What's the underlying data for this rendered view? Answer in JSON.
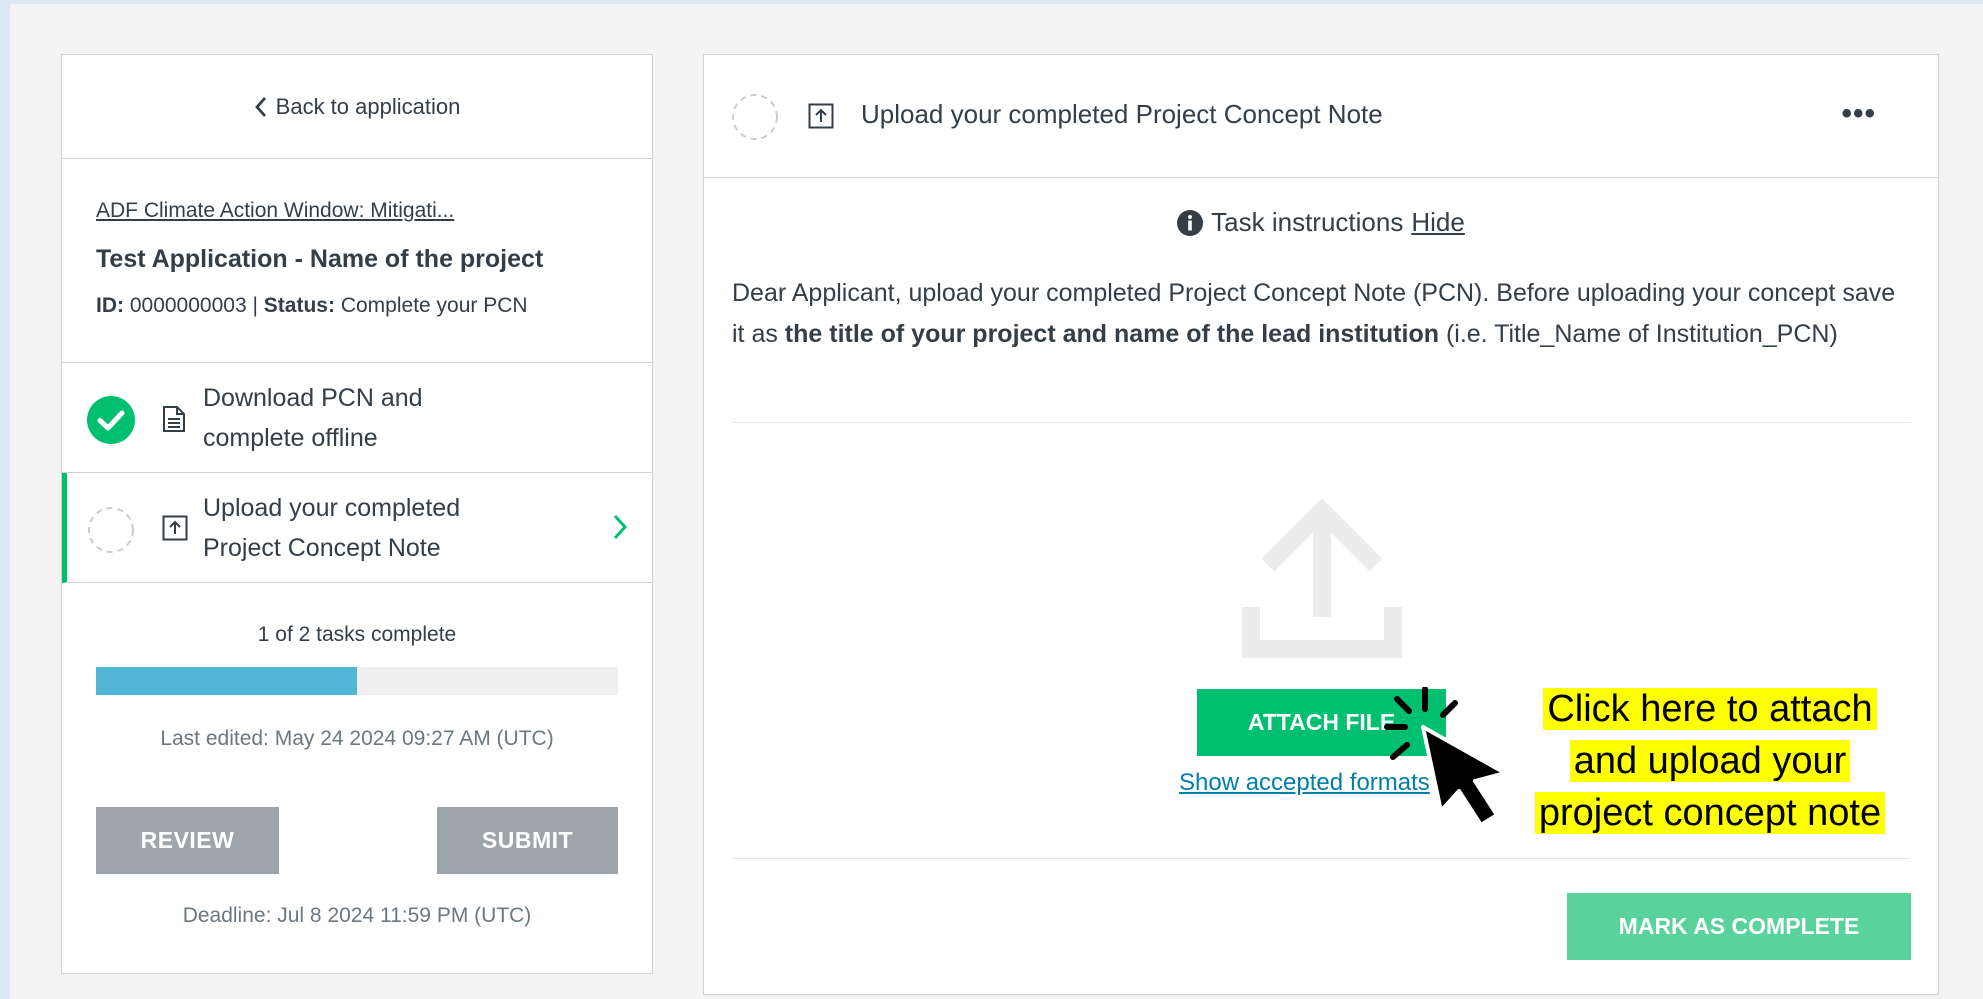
{
  "sidebar": {
    "back_label": "Back to application",
    "app_link": "ADF Climate Action Window: Mitigati...",
    "app_title": "Test Application - Name of the project",
    "id_label": "ID:",
    "id_value": "0000000003",
    "separator": "|",
    "status_label": "Status:",
    "status_value": "Complete your PCN",
    "tasks": [
      {
        "label": "Download PCN and complete offline",
        "state": "complete",
        "icon": "document-icon"
      },
      {
        "label": "Upload your completed Project Concept Note",
        "state": "active",
        "icon": "upload-box-icon"
      }
    ],
    "progress_text": "1 of 2 tasks complete",
    "progress_fraction": 0.5,
    "last_edited": "Last edited: May 24 2024 09:27 AM (UTC)",
    "review_label": "REVIEW",
    "submit_label": "SUBMIT",
    "deadline": "Deadline: Jul 8 2024 11:59 PM (UTC)"
  },
  "main": {
    "title": "Upload your completed Project Concept Note",
    "more_label": "•••",
    "instructions_label": "Task instructions",
    "hide_label": "Hide",
    "body_part1": "Dear Applicant, upload your completed Project Concept Note (PCN). Before uploading your concept save it as ",
    "body_bold": "the title of your project and name of the lead institution",
    "body_part2": " (i.e. Title_Name of Institution_PCN)",
    "attach_label": "ATTACH FILE",
    "formats_label": "Show accepted formats",
    "mark_complete_label": "MARK AS COMPLETE"
  },
  "annotation": {
    "line1": "Click here to attach",
    "line2": "and upload your",
    "line3": "project concept note",
    "highlight_color": "#ffff00"
  },
  "colors": {
    "accent_green": "#00bf6f",
    "progress_blue": "#51b5d6",
    "link_blue": "#007faa",
    "disabled_gray": "#9da5ab"
  }
}
